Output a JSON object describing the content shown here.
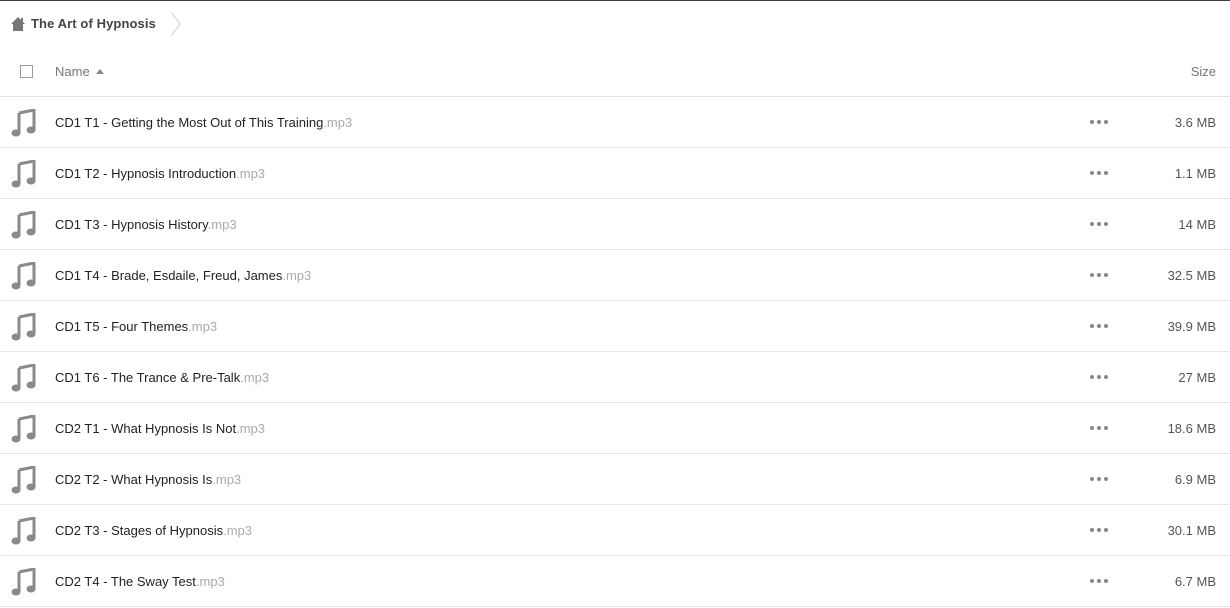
{
  "breadcrumb": {
    "home_icon": "home-icon",
    "folder": "The Art of Hypnosis"
  },
  "header": {
    "name_label": "Name",
    "size_label": "Size",
    "sort": "ascending"
  },
  "files": [
    {
      "name": "CD1 T1 - Getting the Most Out of This Training",
      "ext": ".mp3",
      "size": "3.6 MB"
    },
    {
      "name": "CD1 T2 - Hypnosis Introduction",
      "ext": ".mp3",
      "size": "1.1 MB"
    },
    {
      "name": "CD1 T3 - Hypnosis History",
      "ext": ".mp3",
      "size": "14 MB"
    },
    {
      "name": "CD1 T4 - Brade, Esdaile, Freud, James",
      "ext": ".mp3",
      "size": "32.5 MB"
    },
    {
      "name": "CD1 T5 - Four Themes",
      "ext": ".mp3",
      "size": "39.9 MB"
    },
    {
      "name": "CD1 T6 - The Trance & Pre-Talk",
      "ext": ".mp3",
      "size": "27 MB"
    },
    {
      "name": "CD2 T1 - What Hypnosis Is Not",
      "ext": ".mp3",
      "size": "18.6 MB"
    },
    {
      "name": "CD2 T2 - What Hypnosis Is",
      "ext": ".mp3",
      "size": "6.9 MB"
    },
    {
      "name": "CD2 T3 - Stages of Hypnosis",
      "ext": ".mp3",
      "size": "30.1 MB"
    },
    {
      "name": "CD2 T4 - The Sway Test",
      "ext": ".mp3",
      "size": "6.7 MB"
    }
  ],
  "colors": {
    "icon": "#8a8a8a",
    "extension": "#aaaaaa",
    "divider": "#e6e6e6"
  }
}
